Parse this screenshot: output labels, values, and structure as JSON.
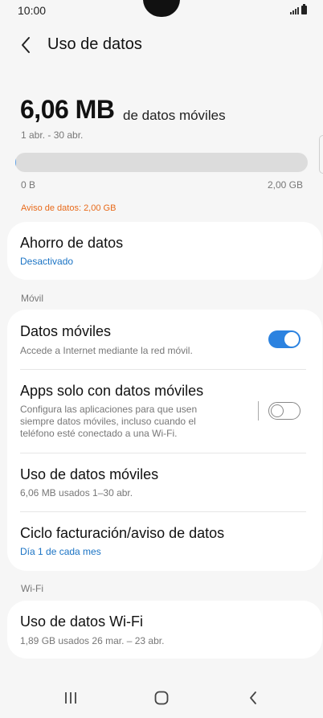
{
  "status_bar": {
    "time": "10:00"
  },
  "header": {
    "title": "Uso de datos"
  },
  "usage": {
    "amount": "6,06 MB",
    "suffix": "de datos móviles",
    "period": "1 abr. - 30 abr.",
    "progress_fraction": 0.003,
    "scale_min": "0 B",
    "scale_max": "2,00 GB",
    "warning": "Aviso de datos: 2,00 GB"
  },
  "data_saver": {
    "title": "Ahorro de datos",
    "status": "Desactivado"
  },
  "mobile_section": {
    "label": "Móvil",
    "items": [
      {
        "title": "Datos móviles",
        "subtitle": "Accede a Internet mediante la red móvil.",
        "toggle": true
      },
      {
        "title": "Apps solo con datos móviles",
        "subtitle_lines": [
          "Configura las aplicaciones para que usen",
          "siempre datos móviles, incluso cuando el",
          "teléfono esté conectado a una Wi-Fi."
        ],
        "toggle": false
      },
      {
        "title": "Uso de datos móviles",
        "subtitle": "6,06 MB usados 1–30 abr."
      },
      {
        "title": "Ciclo facturación/aviso de datos",
        "subtitle": "Día 1 de cada mes"
      }
    ]
  },
  "wifi_section": {
    "label": "Wi-Fi",
    "items": [
      {
        "title": "Uso de datos Wi-Fi",
        "subtitle": "1,89 GB usados 26 mar. – 23 abr."
      }
    ]
  },
  "colors": {
    "accent": "#2b82e0",
    "link": "#1a73c4",
    "warning": "#e86a1a",
    "progress_fill": "#5aa0e8"
  },
  "icons": {
    "back": "chevron-left-icon",
    "nav_recent": "recent-apps-icon",
    "nav_home": "home-icon",
    "nav_back": "back-icon"
  }
}
